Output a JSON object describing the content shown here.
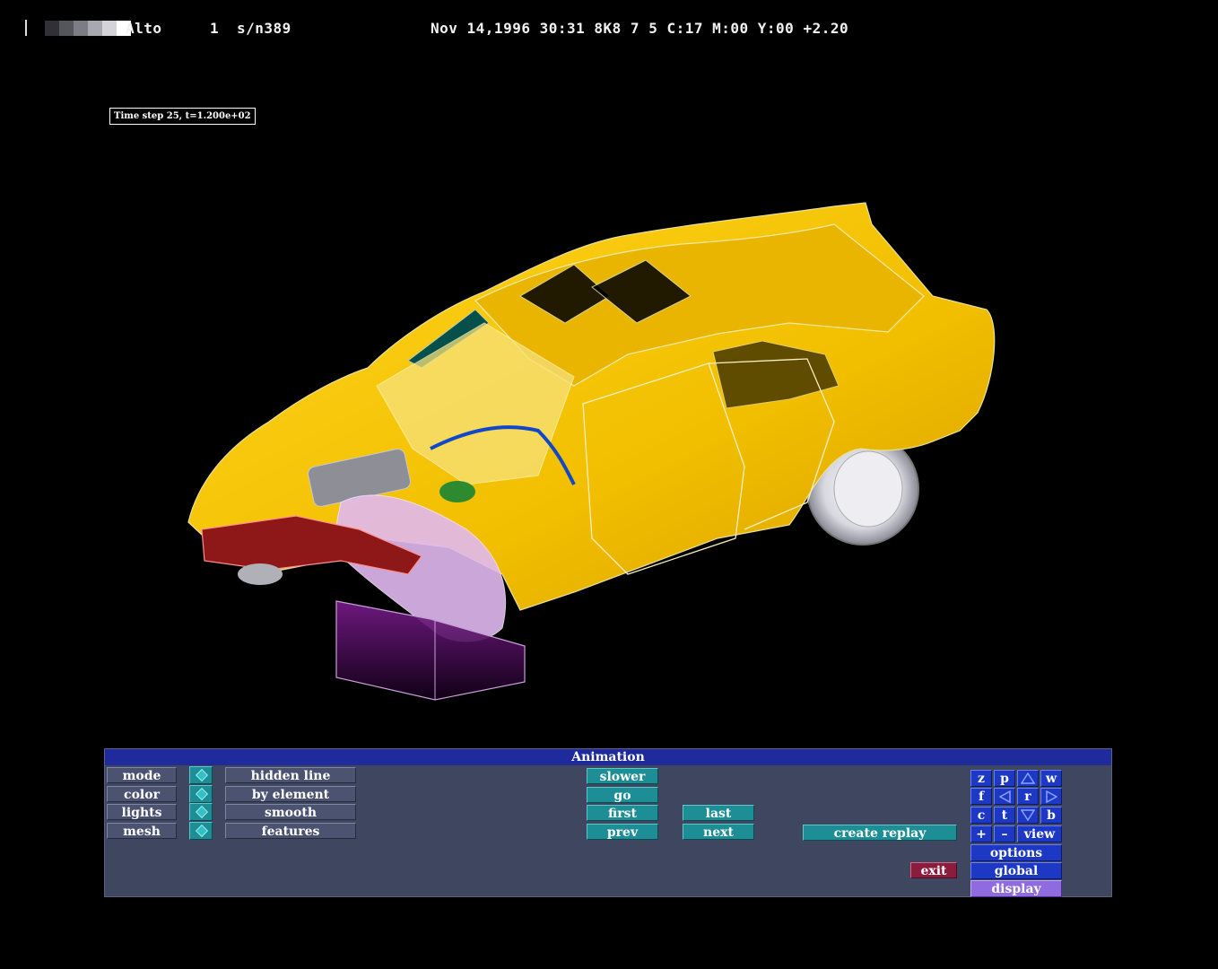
{
  "header": {
    "app_name": "Alto",
    "channel": "1",
    "serial": "s/n389",
    "status_line": "Nov 14,1996 30:31 8K8 7 5 C:17 M:00 Y:00 +2.20"
  },
  "viewport": {
    "time_step_label": "Time step 25, t=1.200e+02"
  },
  "panel": {
    "title": "Animation",
    "left_rows": [
      {
        "label": "mode",
        "value": "hidden line"
      },
      {
        "label": "color",
        "value": "by element"
      },
      {
        "label": "lights",
        "value": "smooth"
      },
      {
        "label": "mesh",
        "value": "features"
      }
    ],
    "playback": {
      "slower": "slower",
      "go": "go",
      "first": "first",
      "prev": "prev",
      "last": "last",
      "next": "next"
    },
    "create_replay": "create replay",
    "exit": "exit",
    "view_grid": {
      "z": "z",
      "p": "p",
      "w": "w",
      "f": "f",
      "r": "r",
      "c": "c",
      "t": "t",
      "b": "b",
      "plus": "+",
      "minus": "–",
      "view": "view"
    },
    "options": "options",
    "global": "global",
    "display": "display"
  },
  "colors": {
    "car_body": "#f2c100",
    "bumper": "#8e1818",
    "engine": "#e1b7f2",
    "panel_bg": "#3f4660",
    "title_bar": "#1f2a9c",
    "teal_button": "#1d8e95",
    "blue_button": "#1c38c4",
    "exit_button": "#8c1c3e",
    "display_button": "#8f6be0"
  }
}
